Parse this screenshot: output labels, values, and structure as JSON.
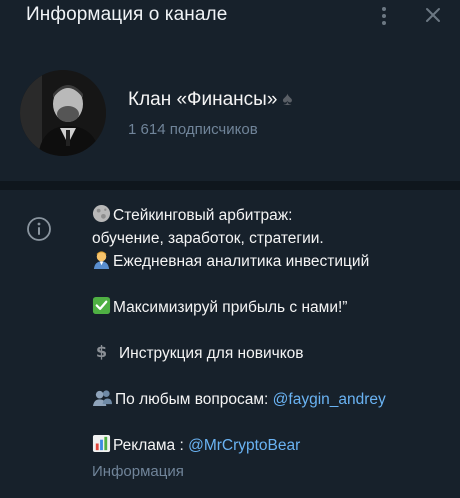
{
  "header": {
    "title": "Информация о канале"
  },
  "channel": {
    "name": "Клан «Финансы»",
    "subscribers": "1 614 подписчиков"
  },
  "about": {
    "line1": "Стейкинговый арбитраж:",
    "line2": "обучение, заработок, стратегии.",
    "line3": "Ежедневная аналитика инвестиций",
    "line4": "Максимизируй прибыль с нами!”",
    "line5": "Инструкция для новичков",
    "line6_prefix": "По любым вопросам: ",
    "line6_link": "@faygin_andrey",
    "line7_prefix": "Реклама : ",
    "line7_link": "@MrCryptoBear",
    "caption": "Информация"
  },
  "icons": {
    "menu": "more-vertical-icon",
    "close": "close-icon",
    "info": "info-icon",
    "spade": "spade-icon"
  },
  "colors": {
    "background": "#17212b",
    "divider": "#0f161d",
    "link": "#6ab3f3",
    "muted": "#708499"
  }
}
